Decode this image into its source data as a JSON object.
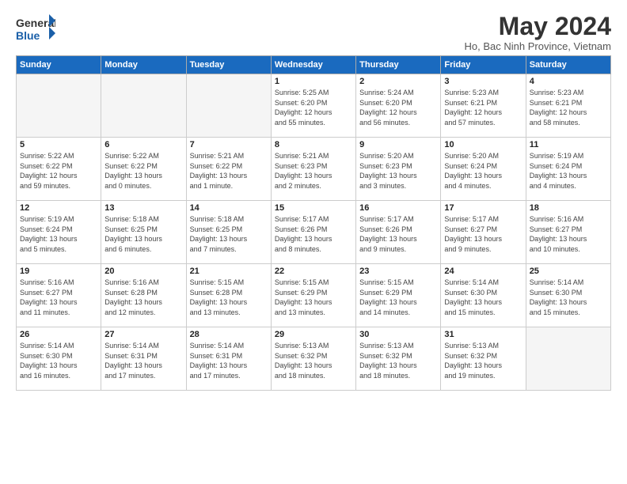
{
  "header": {
    "logo_general": "General",
    "logo_blue": "Blue",
    "month_year": "May 2024",
    "location": "Ho, Bac Ninh Province, Vietnam"
  },
  "days_of_week": [
    "Sunday",
    "Monday",
    "Tuesday",
    "Wednesday",
    "Thursday",
    "Friday",
    "Saturday"
  ],
  "weeks": [
    [
      {
        "num": "",
        "info": ""
      },
      {
        "num": "",
        "info": ""
      },
      {
        "num": "",
        "info": ""
      },
      {
        "num": "1",
        "info": "Sunrise: 5:25 AM\nSunset: 6:20 PM\nDaylight: 12 hours\nand 55 minutes."
      },
      {
        "num": "2",
        "info": "Sunrise: 5:24 AM\nSunset: 6:20 PM\nDaylight: 12 hours\nand 56 minutes."
      },
      {
        "num": "3",
        "info": "Sunrise: 5:23 AM\nSunset: 6:21 PM\nDaylight: 12 hours\nand 57 minutes."
      },
      {
        "num": "4",
        "info": "Sunrise: 5:23 AM\nSunset: 6:21 PM\nDaylight: 12 hours\nand 58 minutes."
      }
    ],
    [
      {
        "num": "5",
        "info": "Sunrise: 5:22 AM\nSunset: 6:22 PM\nDaylight: 12 hours\nand 59 minutes."
      },
      {
        "num": "6",
        "info": "Sunrise: 5:22 AM\nSunset: 6:22 PM\nDaylight: 13 hours\nand 0 minutes."
      },
      {
        "num": "7",
        "info": "Sunrise: 5:21 AM\nSunset: 6:22 PM\nDaylight: 13 hours\nand 1 minute."
      },
      {
        "num": "8",
        "info": "Sunrise: 5:21 AM\nSunset: 6:23 PM\nDaylight: 13 hours\nand 2 minutes."
      },
      {
        "num": "9",
        "info": "Sunrise: 5:20 AM\nSunset: 6:23 PM\nDaylight: 13 hours\nand 3 minutes."
      },
      {
        "num": "10",
        "info": "Sunrise: 5:20 AM\nSunset: 6:24 PM\nDaylight: 13 hours\nand 4 minutes."
      },
      {
        "num": "11",
        "info": "Sunrise: 5:19 AM\nSunset: 6:24 PM\nDaylight: 13 hours\nand 4 minutes."
      }
    ],
    [
      {
        "num": "12",
        "info": "Sunrise: 5:19 AM\nSunset: 6:24 PM\nDaylight: 13 hours\nand 5 minutes."
      },
      {
        "num": "13",
        "info": "Sunrise: 5:18 AM\nSunset: 6:25 PM\nDaylight: 13 hours\nand 6 minutes."
      },
      {
        "num": "14",
        "info": "Sunrise: 5:18 AM\nSunset: 6:25 PM\nDaylight: 13 hours\nand 7 minutes."
      },
      {
        "num": "15",
        "info": "Sunrise: 5:17 AM\nSunset: 6:26 PM\nDaylight: 13 hours\nand 8 minutes."
      },
      {
        "num": "16",
        "info": "Sunrise: 5:17 AM\nSunset: 6:26 PM\nDaylight: 13 hours\nand 9 minutes."
      },
      {
        "num": "17",
        "info": "Sunrise: 5:17 AM\nSunset: 6:27 PM\nDaylight: 13 hours\nand 9 minutes."
      },
      {
        "num": "18",
        "info": "Sunrise: 5:16 AM\nSunset: 6:27 PM\nDaylight: 13 hours\nand 10 minutes."
      }
    ],
    [
      {
        "num": "19",
        "info": "Sunrise: 5:16 AM\nSunset: 6:27 PM\nDaylight: 13 hours\nand 11 minutes."
      },
      {
        "num": "20",
        "info": "Sunrise: 5:16 AM\nSunset: 6:28 PM\nDaylight: 13 hours\nand 12 minutes."
      },
      {
        "num": "21",
        "info": "Sunrise: 5:15 AM\nSunset: 6:28 PM\nDaylight: 13 hours\nand 13 minutes."
      },
      {
        "num": "22",
        "info": "Sunrise: 5:15 AM\nSunset: 6:29 PM\nDaylight: 13 hours\nand 13 minutes."
      },
      {
        "num": "23",
        "info": "Sunrise: 5:15 AM\nSunset: 6:29 PM\nDaylight: 13 hours\nand 14 minutes."
      },
      {
        "num": "24",
        "info": "Sunrise: 5:14 AM\nSunset: 6:30 PM\nDaylight: 13 hours\nand 15 minutes."
      },
      {
        "num": "25",
        "info": "Sunrise: 5:14 AM\nSunset: 6:30 PM\nDaylight: 13 hours\nand 15 minutes."
      }
    ],
    [
      {
        "num": "26",
        "info": "Sunrise: 5:14 AM\nSunset: 6:30 PM\nDaylight: 13 hours\nand 16 minutes."
      },
      {
        "num": "27",
        "info": "Sunrise: 5:14 AM\nSunset: 6:31 PM\nDaylight: 13 hours\nand 17 minutes."
      },
      {
        "num": "28",
        "info": "Sunrise: 5:14 AM\nSunset: 6:31 PM\nDaylight: 13 hours\nand 17 minutes."
      },
      {
        "num": "29",
        "info": "Sunrise: 5:13 AM\nSunset: 6:32 PM\nDaylight: 13 hours\nand 18 minutes."
      },
      {
        "num": "30",
        "info": "Sunrise: 5:13 AM\nSunset: 6:32 PM\nDaylight: 13 hours\nand 18 minutes."
      },
      {
        "num": "31",
        "info": "Sunrise: 5:13 AM\nSunset: 6:32 PM\nDaylight: 13 hours\nand 19 minutes."
      },
      {
        "num": "",
        "info": ""
      }
    ]
  ]
}
